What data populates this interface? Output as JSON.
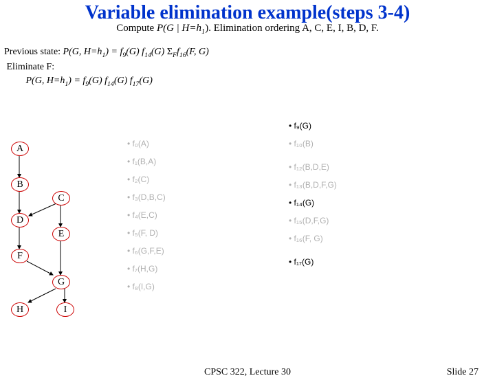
{
  "title": "Variable elimination example(steps 3-4)",
  "subtitle_pre": "Compute ",
  "subtitle_mid": "P(G | H=h",
  "subtitle_sub": "1",
  "subtitle_post": "). Elimination ordering A, C, E, I, B, D, F.",
  "prev_label": "Previous state: ",
  "prev_expr_a": "P(G, H=h",
  "prev_expr_b": ") = f",
  "prev_expr_c": "(G) f",
  "prev_expr_d": "(G) ",
  "prev_expr_e": "f",
  "prev_expr_f": "(F, G)",
  "prev_sum": "Σ",
  "prev_sum_sub": "F",
  "elim_label": "Eliminate F:",
  "after_a": "P(G, H=h",
  "after_b": ") = f",
  "after_c": "(G) f",
  "after_d": "(G) f",
  "after_e": "(G)",
  "s1": "1",
  "s9": "9",
  "s14": "14",
  "s16": "16",
  "s17": "17",
  "nodes": {
    "A": "A",
    "B": "B",
    "C": "C",
    "D": "D",
    "E": "E",
    "F": "F",
    "G": "G",
    "H": "H",
    "I": "I"
  },
  "fL": {
    "f0": "f₀(A)",
    "f1": "f₁(B,A)",
    "f2": "f₂(C)",
    "f3": "f₃(D,B,C)",
    "f4": "f₄(E,C)",
    "f5": "f₅(F, D)",
    "f6": "f₆(G,F,E)",
    "f7": "f₇(H,G)",
    "f8": "f₈(I,G)"
  },
  "fR": {
    "f9": "f₉(G)",
    "f10": "f₁₀(B)",
    "f12": "f₁₂(B,D,E)",
    "f13": "f₁₃(B,D,F,G)",
    "f14": "f₁₄(G)",
    "f15": "f₁₅(D,F,G)",
    "f16": "f₁₆(F, G)",
    "f17": "f₁₇(G)"
  },
  "footer_mid": "CPSC 322, Lecture 30",
  "footer_right": "Slide 27"
}
